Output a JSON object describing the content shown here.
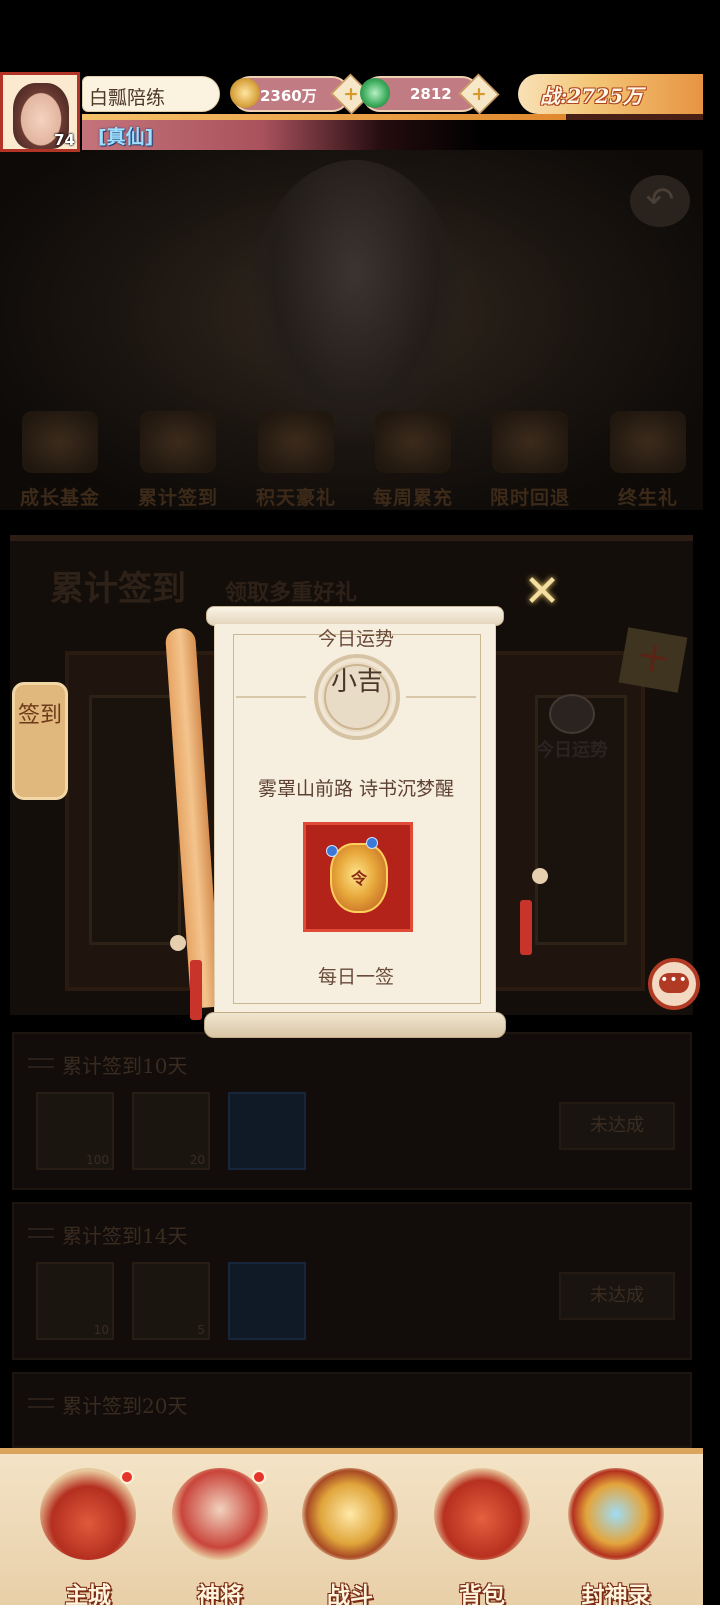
{
  "player": {
    "name": "白瓢陪练",
    "level": "74",
    "title": "[真仙]",
    "exp_fraction": 0.78
  },
  "resources": {
    "copper": "2360万",
    "jade": "2812",
    "power": "战:2725万"
  },
  "activity_tabs": [
    "成长基金",
    "累计签到",
    "积天豪礼",
    "每周累充",
    "限时回退",
    "终生礼"
  ],
  "signin": {
    "title": "累计签到",
    "subtitle": "领取多重好礼",
    "side_tag": "签到",
    "fortune_label": "今日运势",
    "calendar_glyph": "十",
    "rows": [
      {
        "title": "累计签到10天",
        "status": "未达成",
        "counts": [
          "100",
          "20",
          ""
        ]
      },
      {
        "title": "累计签到14天",
        "status": "未达成",
        "counts": [
          "10",
          "5",
          ""
        ]
      },
      {
        "title": "累计签到20天",
        "status": "",
        "counts": []
      }
    ]
  },
  "fortune": {
    "header": "今日运势",
    "result": "小吉",
    "poem": "雾罩山前路  诗书沉梦醒",
    "item_glyph": "令",
    "footer": "每日一签",
    "close_glyph": "✕"
  },
  "nav": [
    {
      "label": "主城",
      "badge": true
    },
    {
      "label": "神将",
      "badge": true
    },
    {
      "label": "战斗",
      "badge": false
    },
    {
      "label": "背包",
      "badge": false
    },
    {
      "label": "封神录",
      "badge": false
    }
  ],
  "icons": {
    "copper": "copper-coin-icon",
    "jade": "jade-icon",
    "chat": "chat-bubble-icon",
    "back": "back-arrow-icon"
  },
  "colors": {
    "accent_red": "#b4231a",
    "gold": "#f3c677",
    "title_blue": "#9fe0ff"
  }
}
